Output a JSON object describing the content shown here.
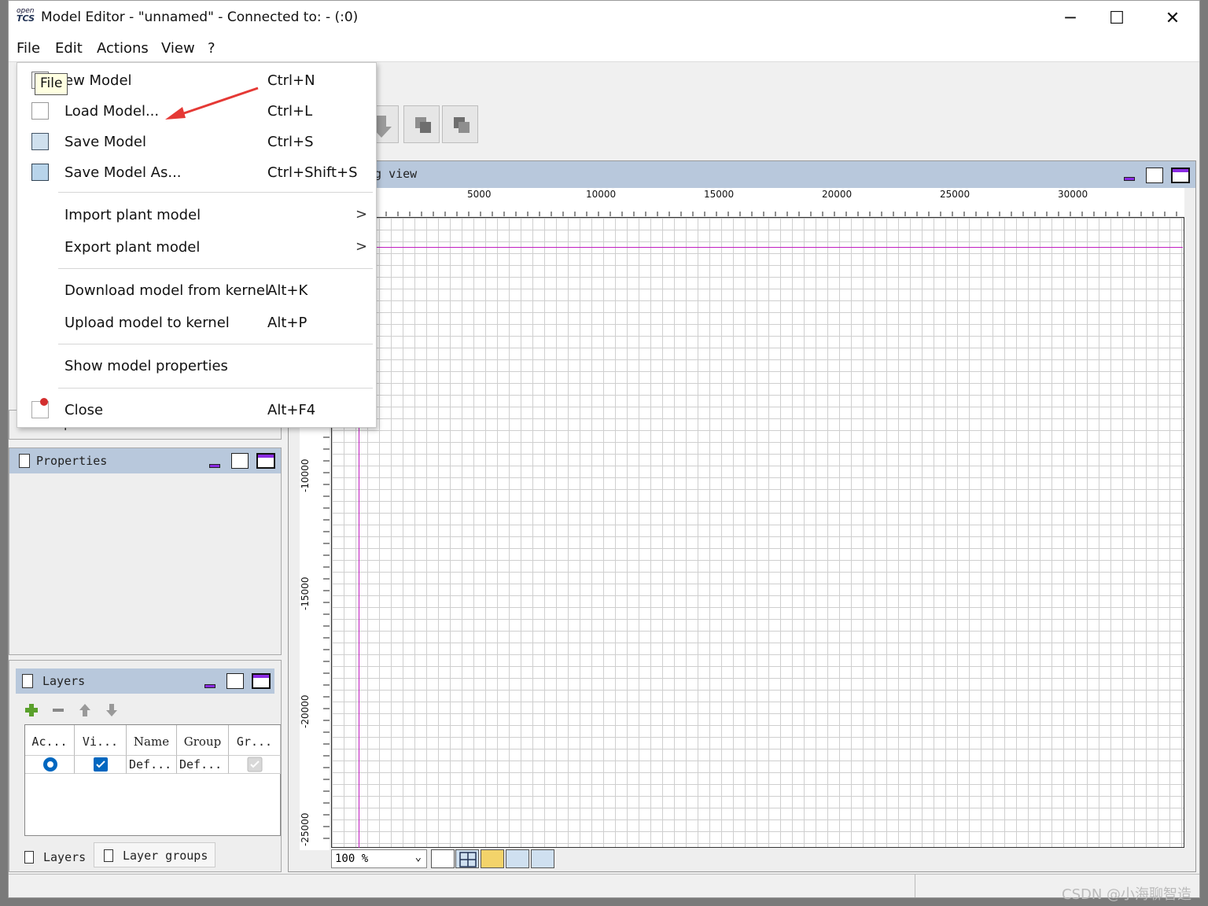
{
  "window": {
    "logo_top": "open",
    "logo_bottom": "TCS",
    "title": "Model Editor - \"unnamed\" - Connected to: - (:0)",
    "controls": {
      "minimize": "─",
      "maximize": "☐",
      "close": "✕"
    }
  },
  "menubar": {
    "items": [
      "File",
      "Edit",
      "Actions",
      "View",
      "?"
    ]
  },
  "tooltip": "File",
  "file_menu": {
    "items": [
      {
        "label": "ew Model",
        "shortcut": "Ctrl+N",
        "icon": "new-model-icon"
      },
      {
        "label": "Load Model...",
        "shortcut": "Ctrl+L",
        "icon": "load-model-icon"
      },
      {
        "label": "Save Model",
        "shortcut": "Ctrl+S",
        "icon": "save-model-icon"
      },
      {
        "label": "Save Model As...",
        "shortcut": "Ctrl+Shift+S",
        "icon": "save-as-icon"
      },
      {
        "label": "Import plant model",
        "shortcut": "",
        "submenu": ">"
      },
      {
        "label": "Export plant model",
        "shortcut": "",
        "submenu": ">"
      },
      {
        "label": "Download model from kernel",
        "shortcut": "Alt+K"
      },
      {
        "label": "Upload model to kernel",
        "shortcut": "Alt+P"
      },
      {
        "label": "Show model properties",
        "shortcut": ""
      },
      {
        "label": "Close",
        "shortcut": "Alt+F4",
        "icon": "close-icon"
      }
    ]
  },
  "drawing_view": {
    "title": "ng view",
    "x_ticks": [
      "5000",
      "10000",
      "15000",
      "20000",
      "25000",
      "30000"
    ],
    "y_ticks": [
      "-10000",
      "-15000",
      "-20000",
      "-25000"
    ],
    "zoom": "100 %"
  },
  "components_tab": "Components",
  "properties_panel": {
    "title": "Properties"
  },
  "layers_panel": {
    "title": "Layers",
    "columns": [
      "Ac...",
      "Vi...",
      "Name",
      "Group",
      "Gr..."
    ],
    "rows": [
      {
        "active": true,
        "visible": true,
        "name": "Def...",
        "group": "Def...",
        "group_visible": true
      }
    ],
    "tabs": [
      "Layers",
      "Layer groups"
    ]
  },
  "watermark": "CSDN @小海聊智造",
  "colors": {
    "accent": "#8a2be2",
    "grid_line": "#c01cc0",
    "panel_header": "#b8c8dc",
    "arrow": "#e53935"
  }
}
